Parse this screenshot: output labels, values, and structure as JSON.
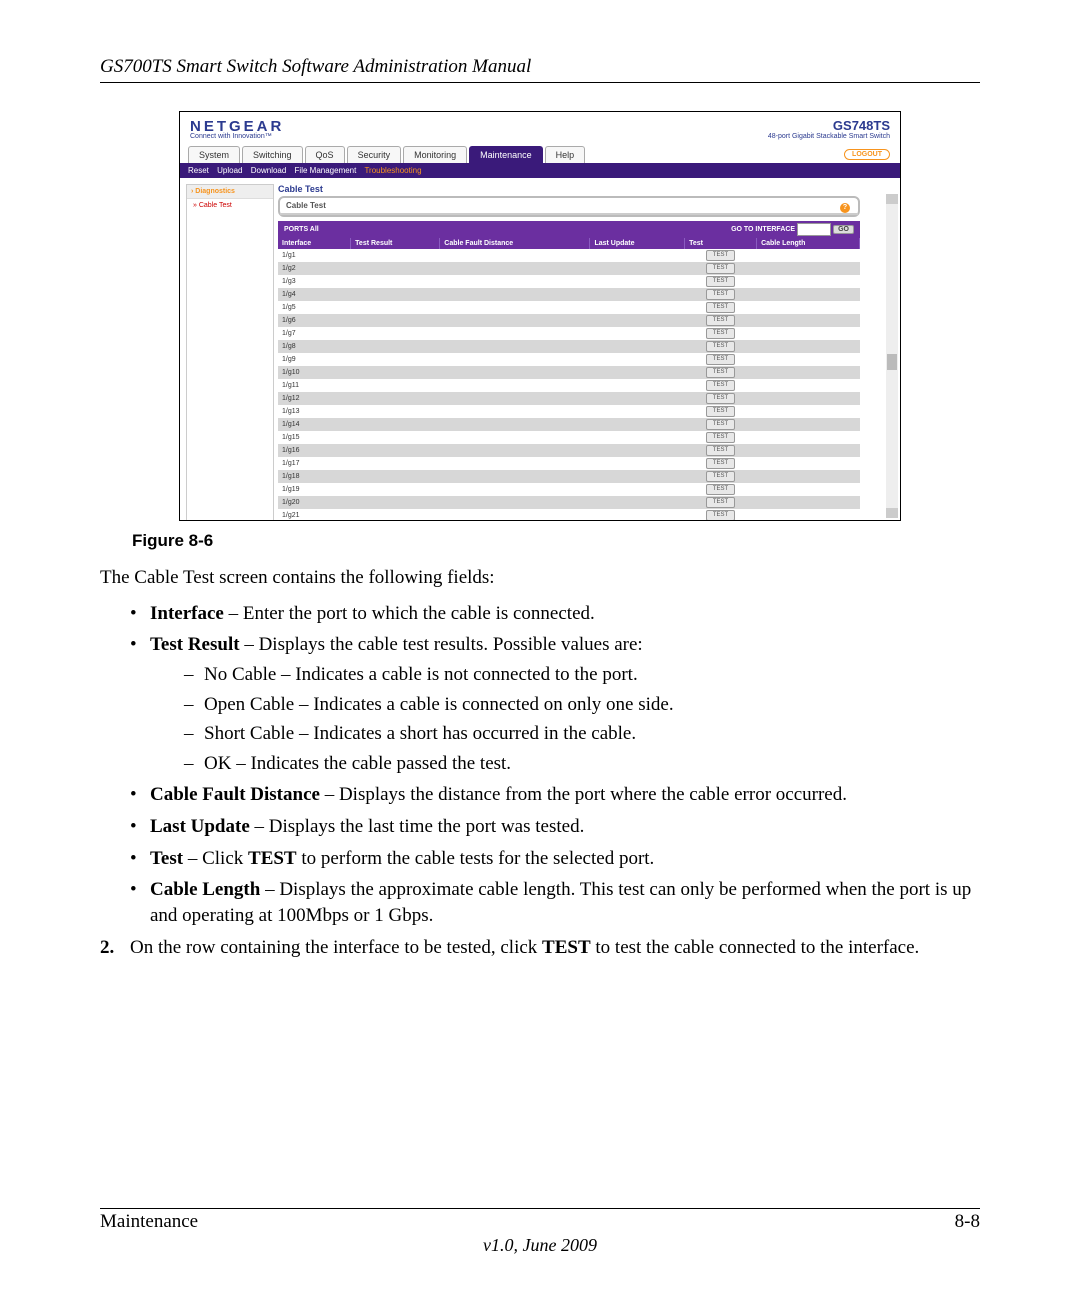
{
  "header": {
    "title": "GS700TS Smart Switch Software Administration Manual"
  },
  "shot": {
    "brand": {
      "logo": "NETGEAR",
      "tagline": "Connect with Innovation™",
      "model": "GS748TS",
      "sub": "48-port Gigabit Stackable Smart Switch"
    },
    "tabs": [
      "System",
      "Switching",
      "QoS",
      "Security",
      "Monitoring",
      "Maintenance",
      "Help"
    ],
    "logout": "LOGOUT",
    "subnav": [
      "Reset",
      "Upload",
      "Download",
      "File Management",
      "Troubleshooting"
    ],
    "leftnav": {
      "header": "› Diagnostics",
      "item": "» Cable Test"
    },
    "section_title": "Cable Test",
    "inner_title": "Cable Test",
    "ports_all": "PORTS All",
    "go_label": "GO TO INTERFACE",
    "go_btn": "GO",
    "columns": [
      "Interface",
      "Test Result",
      "Cable Fault Distance",
      "Last Update",
      "Test",
      "Cable Length"
    ],
    "rows": [
      {
        "iface": "1/g1",
        "btn": "TEST"
      },
      {
        "iface": "1/g2",
        "btn": "TEST"
      },
      {
        "iface": "1/g3",
        "btn": "TEST"
      },
      {
        "iface": "1/g4",
        "btn": "TEST"
      },
      {
        "iface": "1/g5",
        "btn": "TEST"
      },
      {
        "iface": "1/g6",
        "btn": "TEST"
      },
      {
        "iface": "1/g7",
        "btn": "TEST"
      },
      {
        "iface": "1/g8",
        "btn": "TEST"
      },
      {
        "iface": "1/g9",
        "btn": "TEST"
      },
      {
        "iface": "1/g10",
        "btn": "TEST"
      },
      {
        "iface": "1/g11",
        "btn": "TEST"
      },
      {
        "iface": "1/g12",
        "btn": "TEST"
      },
      {
        "iface": "1/g13",
        "btn": "TEST"
      },
      {
        "iface": "1/g14",
        "btn": "TEST"
      },
      {
        "iface": "1/g15",
        "btn": "TEST"
      },
      {
        "iface": "1/g16",
        "btn": "TEST"
      },
      {
        "iface": "1/g17",
        "btn": "TEST"
      },
      {
        "iface": "1/g18",
        "btn": "TEST"
      },
      {
        "iface": "1/g19",
        "btn": "TEST"
      },
      {
        "iface": "1/g20",
        "btn": "TEST"
      },
      {
        "iface": "1/g21",
        "btn": "TEST"
      }
    ]
  },
  "caption": "Figure 8-6",
  "body": {
    "intro": "The Cable Test screen contains the following fields:",
    "fields": [
      {
        "term": "Interface",
        "desc": " – Enter the port to which the cable is connected."
      },
      {
        "term": "Test Result",
        "desc": " – Displays the cable test results. Possible values are:",
        "sub": [
          "No Cable – Indicates a cable is not connected to the port.",
          "Open Cable – Indicates a cable is connected on only one side.",
          "Short Cable – Indicates a short has occurred in the cable.",
          "OK – Indicates the cable passed the test."
        ]
      },
      {
        "term": "Cable Fault Distance",
        "desc": " – Displays the distance from the port where the cable error occurred."
      },
      {
        "term": "Last Update",
        "desc": " – Displays the last time the port was tested."
      },
      {
        "term": "Test",
        "desc_pre": " – Click ",
        "bold": "TEST",
        "desc_post": " to perform the cable tests for the selected port."
      },
      {
        "term": "Cable Length",
        "desc": " – Displays the approximate cable length. This test can only be performed when the port is up and operating at 100Mbps or 1 Gbps."
      }
    ],
    "step": {
      "num": "2.",
      "pre": "On the row containing the interface to be tested, click ",
      "bold": "TEST",
      "post": " to test the cable connected to the interface."
    }
  },
  "footer": {
    "section": "Maintenance",
    "page": "8-8",
    "version": "v1.0, June 2009"
  }
}
